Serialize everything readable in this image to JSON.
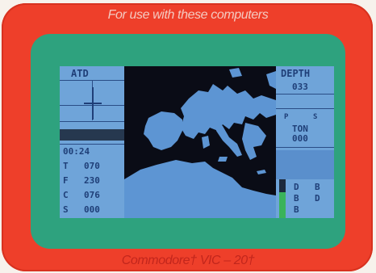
{
  "promo": {
    "header": "For use with these computers",
    "footer": "Commodore† VIC – 20†"
  },
  "hud": {
    "left": {
      "scope_label": "ATD",
      "readouts": [
        {
          "letter": "",
          "value": "00:24"
        },
        {
          "letter": "T",
          "value": "070"
        },
        {
          "letter": "F",
          "value": "230"
        },
        {
          "letter": "C",
          "value": "076"
        },
        {
          "letter": "S",
          "value": "000"
        }
      ]
    },
    "right": {
      "depth_label": "DEPTH",
      "depth_value": "033",
      "mini_labels": [
        "P",
        "S"
      ],
      "ton_label": "TON",
      "ton_value": "000",
      "gauge_letters": [
        "D",
        "B",
        "B",
        "D",
        "B"
      ]
    }
  },
  "colors": {
    "frame": "#ee3f2a",
    "bezel": "#2ea27e",
    "screen": "#6fa7df",
    "map_bg": "#0a0c16",
    "land": "#5d95d3",
    "text": "#1f3f78"
  },
  "icons": {
    "scope": "crosshair-icon",
    "map": "mediterranean-map-icon",
    "gauge": "green-gauge-bar-icon"
  }
}
